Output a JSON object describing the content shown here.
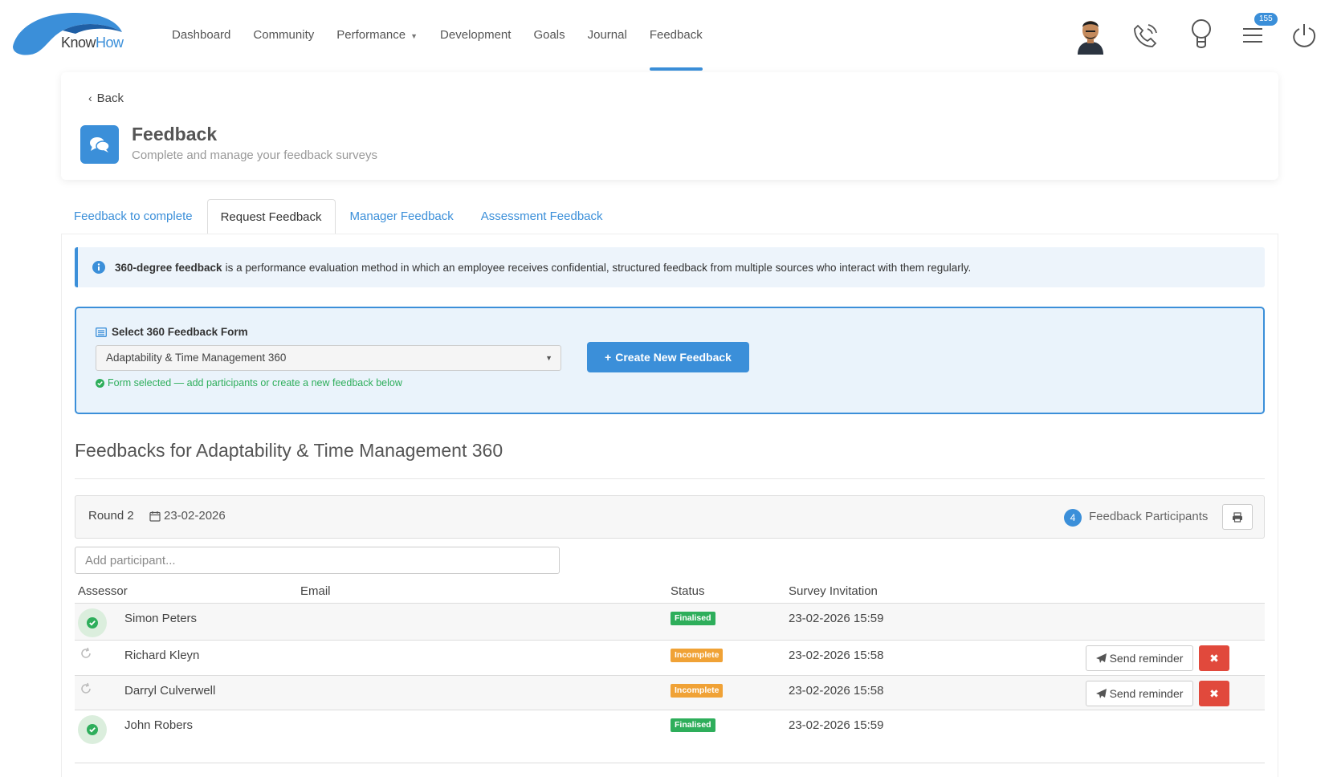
{
  "brand": {
    "logo_part1": "Know",
    "logo_part2": "How",
    "accent": "#3b8fd9"
  },
  "nav": {
    "items": [
      {
        "label": "Dashboard"
      },
      {
        "label": "Community"
      },
      {
        "label": "Performance"
      },
      {
        "label": "Development"
      },
      {
        "label": "Goals"
      },
      {
        "label": "Journal"
      },
      {
        "label": "Feedback"
      }
    ],
    "active": "Feedback",
    "notification_count": "155",
    "icons": [
      "avatar",
      "phone-icon",
      "lightbulb-icon",
      "menu-icon",
      "power-icon"
    ]
  },
  "header": {
    "back_label": "Back",
    "title": "Feedback",
    "subtitle": "Complete and manage your feedback surveys"
  },
  "tabs": [
    {
      "label": "Feedback to complete"
    },
    {
      "label": "Request Feedback"
    },
    {
      "label": "Manager Feedback"
    },
    {
      "label": "Assessment Feedback"
    }
  ],
  "active_tab": "Request Feedback",
  "info": {
    "bold": "360-degree feedback",
    "text": "is a performance evaluation method in which an employee receives confidential, structured feedback from multiple sources who interact with them regularly."
  },
  "form_select": {
    "label": "Select 360 Feedback Form",
    "value": "Adaptability & Time Management 360",
    "hint": "Form selected — add participants or create a new feedback below",
    "create_button": "Create New Feedback"
  },
  "section_title": "Feedbacks for Adaptability & Time Management 360",
  "round": {
    "label": "Round 2",
    "date": "23-02-2026",
    "participant_count": "4",
    "participants_label": "Feedback Participants"
  },
  "add_participant_placeholder": "Add participant...",
  "table": {
    "columns": [
      "Assessor",
      "Email",
      "Status",
      "Survey Invitation"
    ],
    "rows": [
      {
        "name": "Simon Peters",
        "email": "",
        "status": "Finalised",
        "invitation": "23-02-2026 15:59"
      },
      {
        "name": "Richard Kleyn",
        "email": "",
        "status": "Incomplete",
        "invitation": "23-02-2026 15:58",
        "action": "Send reminder"
      },
      {
        "name": "Darryl Culverwell",
        "email": "",
        "status": "Incomplete",
        "invitation": "23-02-2026 15:58",
        "action": "Send reminder"
      },
      {
        "name": "John Robers",
        "email": "",
        "status": "Finalised",
        "invitation": "23-02-2026 15:59"
      }
    ]
  },
  "colors": {
    "finalised": "#2eae5b",
    "incomplete": "#f0a236",
    "danger": "#e1493c"
  }
}
